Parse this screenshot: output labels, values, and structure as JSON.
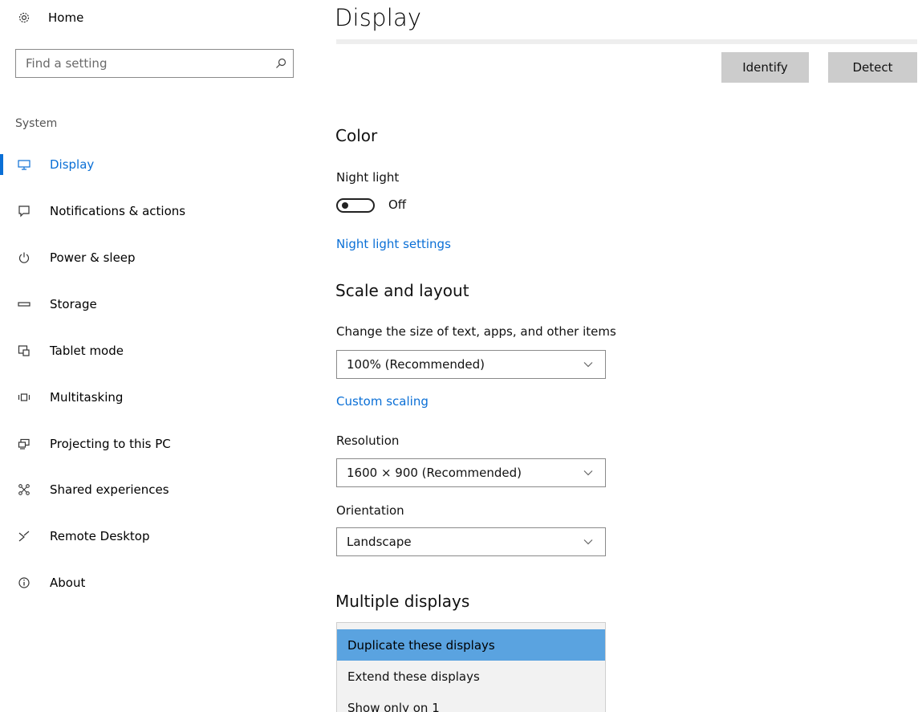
{
  "sidebar": {
    "home_label": "Home",
    "search_placeholder": "Find a setting",
    "section_label": "System",
    "items": [
      {
        "label": "Display",
        "icon": "monitor-icon",
        "selected": true
      },
      {
        "label": "Notifications & actions",
        "icon": "notification-icon"
      },
      {
        "label": "Power & sleep",
        "icon": "power-icon"
      },
      {
        "label": "Storage",
        "icon": "storage-icon"
      },
      {
        "label": "Tablet mode",
        "icon": "tablet-mode-icon"
      },
      {
        "label": "Multitasking",
        "icon": "multitasking-icon"
      },
      {
        "label": "Projecting to this PC",
        "icon": "projecting-icon"
      },
      {
        "label": "Shared experiences",
        "icon": "shared-experiences-icon"
      },
      {
        "label": "Remote Desktop",
        "icon": "remote-desktop-icon"
      },
      {
        "label": "About",
        "icon": "info-icon"
      }
    ]
  },
  "main": {
    "title": "Display",
    "buttons": {
      "identify": "Identify",
      "detect": "Detect"
    },
    "color": {
      "heading": "Color",
      "night_light_label": "Night light",
      "night_light_state": "Off",
      "night_light_settings_link": "Night light settings"
    },
    "scale": {
      "heading": "Scale and layout",
      "size_label": "Change the size of text, apps, and other items",
      "size_value": "100% (Recommended)",
      "custom_scaling_link": "Custom scaling",
      "resolution_label": "Resolution",
      "resolution_value": "1600 × 900 (Recommended)",
      "orientation_label": "Orientation",
      "orientation_value": "Landscape"
    },
    "multiple": {
      "heading": "Multiple displays",
      "options": [
        "Duplicate these displays",
        "Extend these displays",
        "Show only on 1"
      ],
      "selected_index": 0
    }
  },
  "colors": {
    "accent": "#0a6fd6",
    "button_bg": "#cccccc",
    "highlight": "#5aa3e0"
  }
}
